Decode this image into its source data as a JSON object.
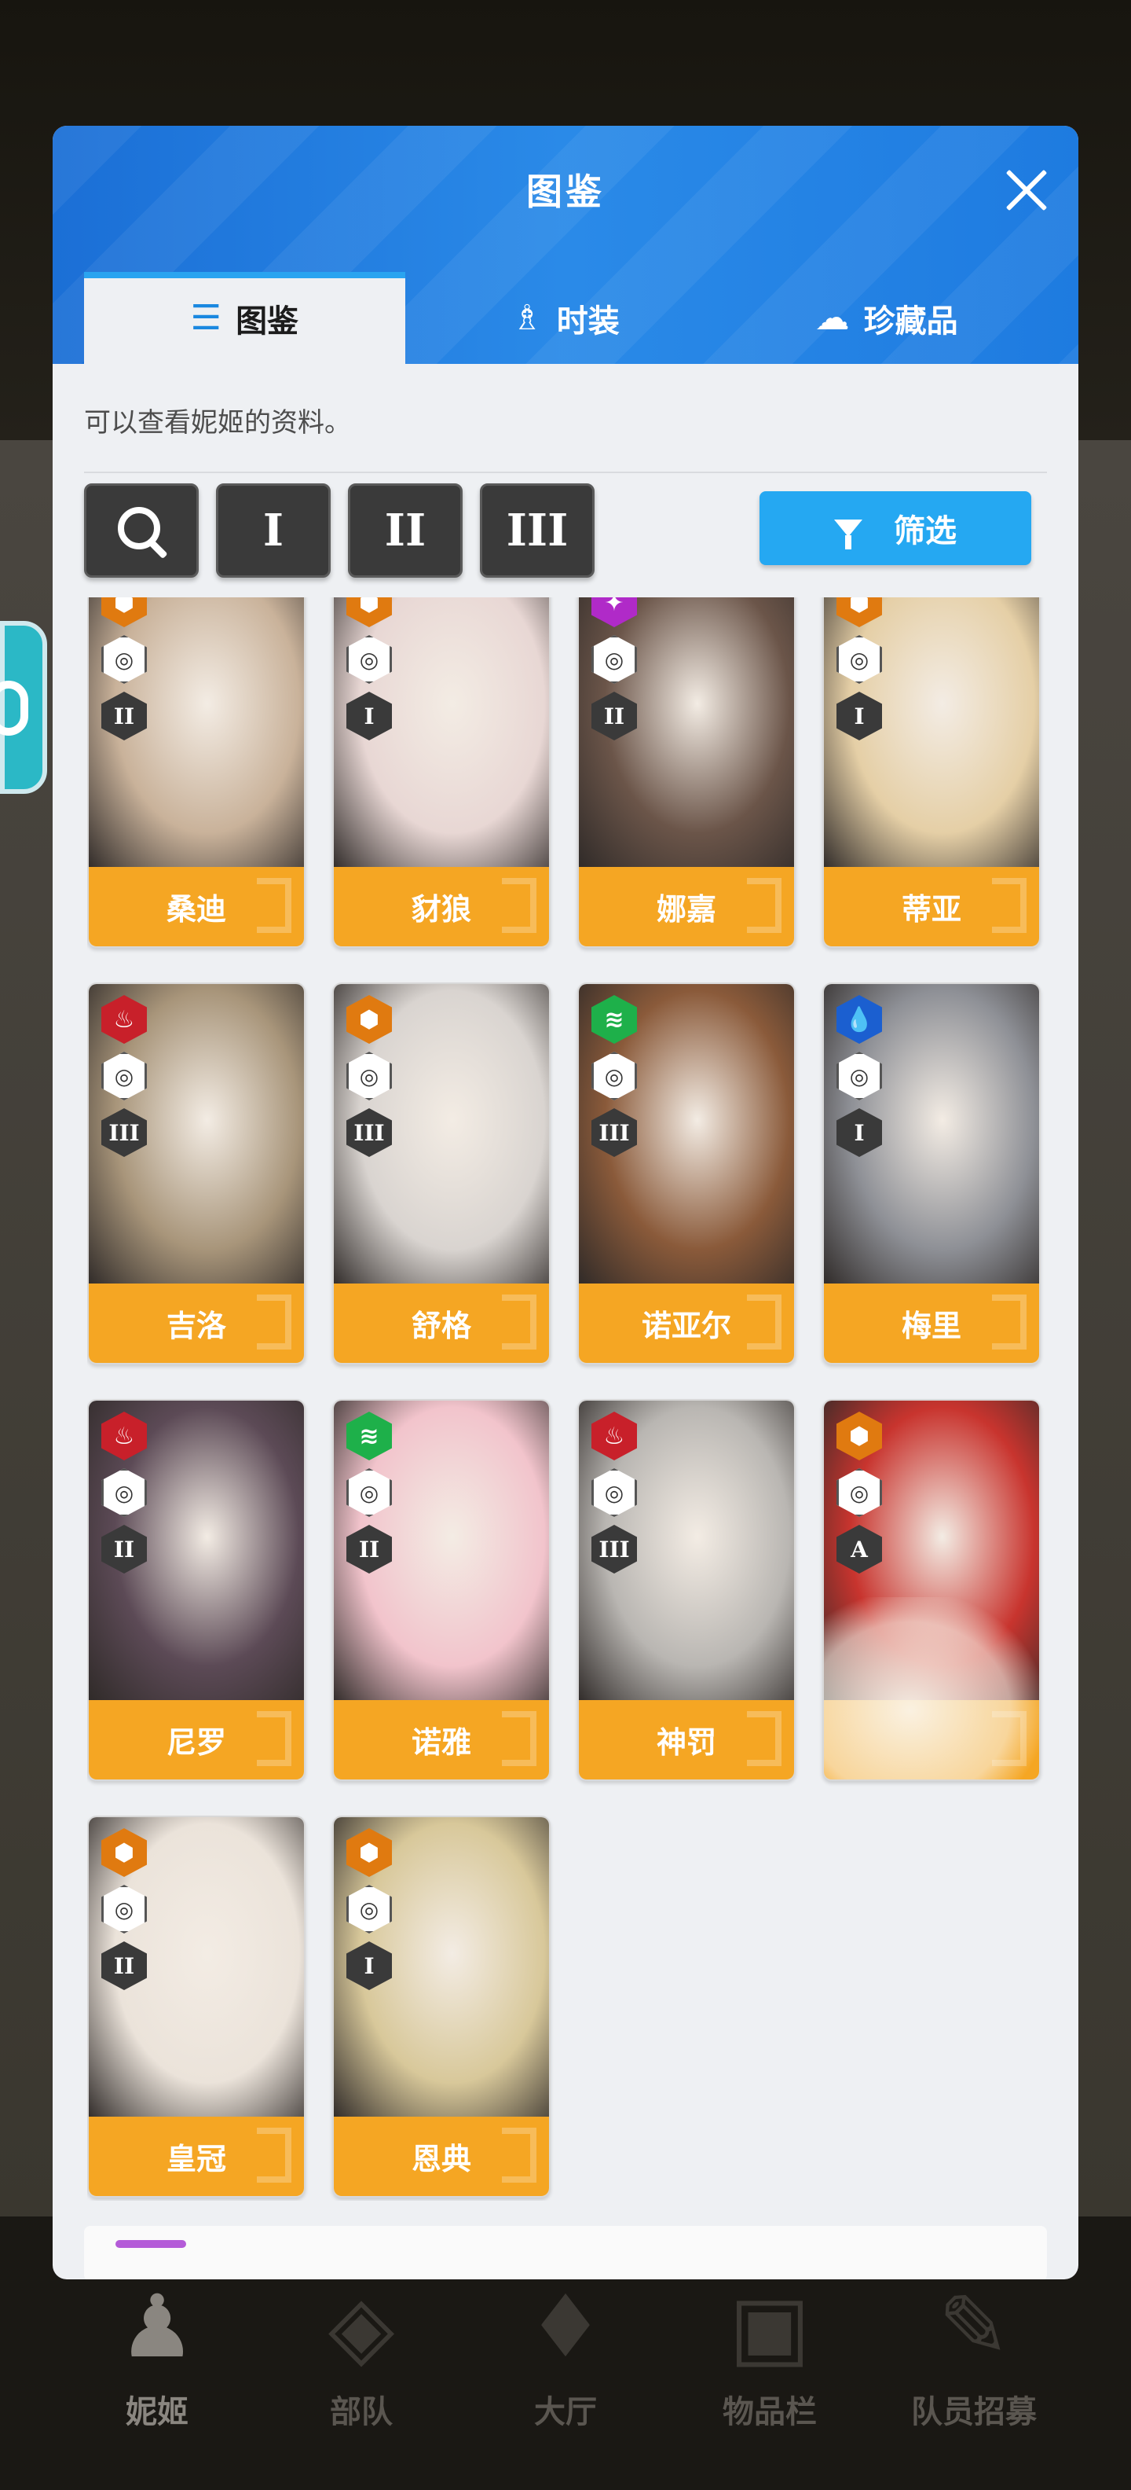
{
  "panel": {
    "title": "图鉴",
    "description": "可以查看妮姬的资料。",
    "tabs": [
      {
        "label": "图鉴",
        "icon": "list-icon",
        "active": true
      },
      {
        "label": "时装",
        "icon": "dress-icon",
        "active": false
      },
      {
        "label": "珍藏品",
        "icon": "planet-icon",
        "active": false
      }
    ],
    "filters": {
      "burst_1": "I",
      "burst_2": "II",
      "burst_3": "III",
      "sift_label": "筛选"
    }
  },
  "cards": [
    {
      "name": "桑迪",
      "element": "electric",
      "element_color": "#e07a10",
      "burst": "II",
      "art_color": "#c9b29a"
    },
    {
      "name": "豺狼",
      "element": "electric",
      "element_color": "#e07a10",
      "burst": "I",
      "art_color": "#e8d7d4"
    },
    {
      "name": "娜嘉",
      "element": "iron",
      "element_color": "#b02ac8",
      "burst": "II",
      "art_color": "#6b5549"
    },
    {
      "name": "蒂亚",
      "element": "electric",
      "element_color": "#e07a10",
      "burst": "I",
      "art_color": "#e5cfa6"
    },
    {
      "name": "吉洛",
      "element": "fire",
      "element_color": "#c8202a",
      "burst": "III",
      "art_color": "#a8957a"
    },
    {
      "name": "舒格",
      "element": "electric",
      "element_color": "#e07a10",
      "burst": "III",
      "art_color": "#d9d4d0"
    },
    {
      "name": "诺亚尔",
      "element": "wind",
      "element_color": "#1eb04a",
      "burst": "III",
      "art_color": "#8a5a3a"
    },
    {
      "name": "梅里",
      "element": "water",
      "element_color": "#1b5fd0",
      "burst": "I",
      "art_color": "#8e9096"
    },
    {
      "name": "尼罗",
      "element": "fire",
      "element_color": "#c8202a",
      "burst": "II",
      "art_color": "#5c4a56"
    },
    {
      "name": "诺雅",
      "element": "wind",
      "element_color": "#1eb04a",
      "burst": "II",
      "art_color": "#f2c4cc"
    },
    {
      "name": "神罚",
      "element": "fire",
      "element_color": "#c8202a",
      "burst": "III",
      "art_color": "#b9b6b2"
    },
    {
      "name": "",
      "element": "electric",
      "element_color": "#e07a10",
      "burst": "A",
      "art_color": "#c8342e"
    },
    {
      "name": "皇冠",
      "element": "electric",
      "element_color": "#e07a10",
      "burst": "II",
      "art_color": "#ebe3da"
    },
    {
      "name": "恩典",
      "element": "electric",
      "element_color": "#e07a10",
      "burst": "I",
      "art_color": "#d8c89a"
    }
  ],
  "bottom_nav": [
    {
      "label": "妮姬",
      "icon": "group-icon",
      "active": true
    },
    {
      "label": "部队",
      "icon": "squad-icon",
      "active": false
    },
    {
      "label": "大厅",
      "icon": "lobby-icon",
      "active": false
    },
    {
      "label": "物品栏",
      "icon": "inventory-icon",
      "active": false
    },
    {
      "label": "队员招募",
      "icon": "recruit-icon",
      "active": false
    }
  ]
}
